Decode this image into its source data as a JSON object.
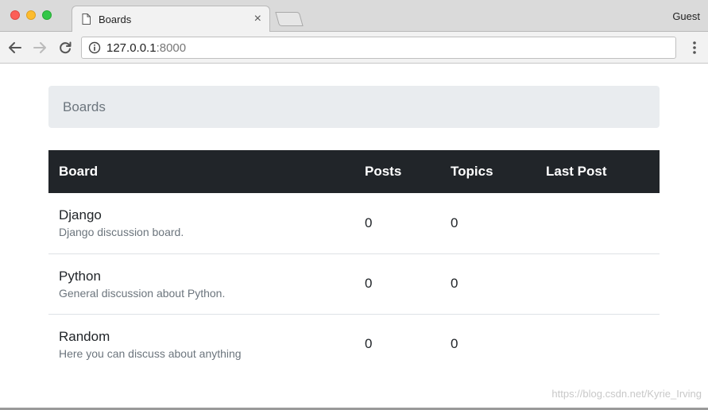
{
  "browser": {
    "tab_title": "Boards",
    "tab_close": "×",
    "profile_name": "Guest",
    "url_host": "127.0.0.1",
    "url_port": ":8000"
  },
  "page": {
    "breadcrumb": "Boards",
    "table": {
      "headers": {
        "board": "Board",
        "posts": "Posts",
        "topics": "Topics",
        "last_post": "Last Post"
      },
      "rows": [
        {
          "name": "Django",
          "description": "Django discussion board.",
          "posts": "0",
          "topics": "0",
          "last_post": ""
        },
        {
          "name": "Python",
          "description": "General discussion about Python.",
          "posts": "0",
          "topics": "0",
          "last_post": ""
        },
        {
          "name": "Random",
          "description": "Here you can discuss about anything",
          "posts": "0",
          "topics": "0",
          "last_post": ""
        }
      ]
    }
  },
  "watermark": "https://blog.csdn.net/Kyrie_Irving",
  "colors": {
    "table_header_bg": "#212529",
    "breadcrumb_bg": "#e9ecef",
    "muted_text": "#6c757d"
  }
}
